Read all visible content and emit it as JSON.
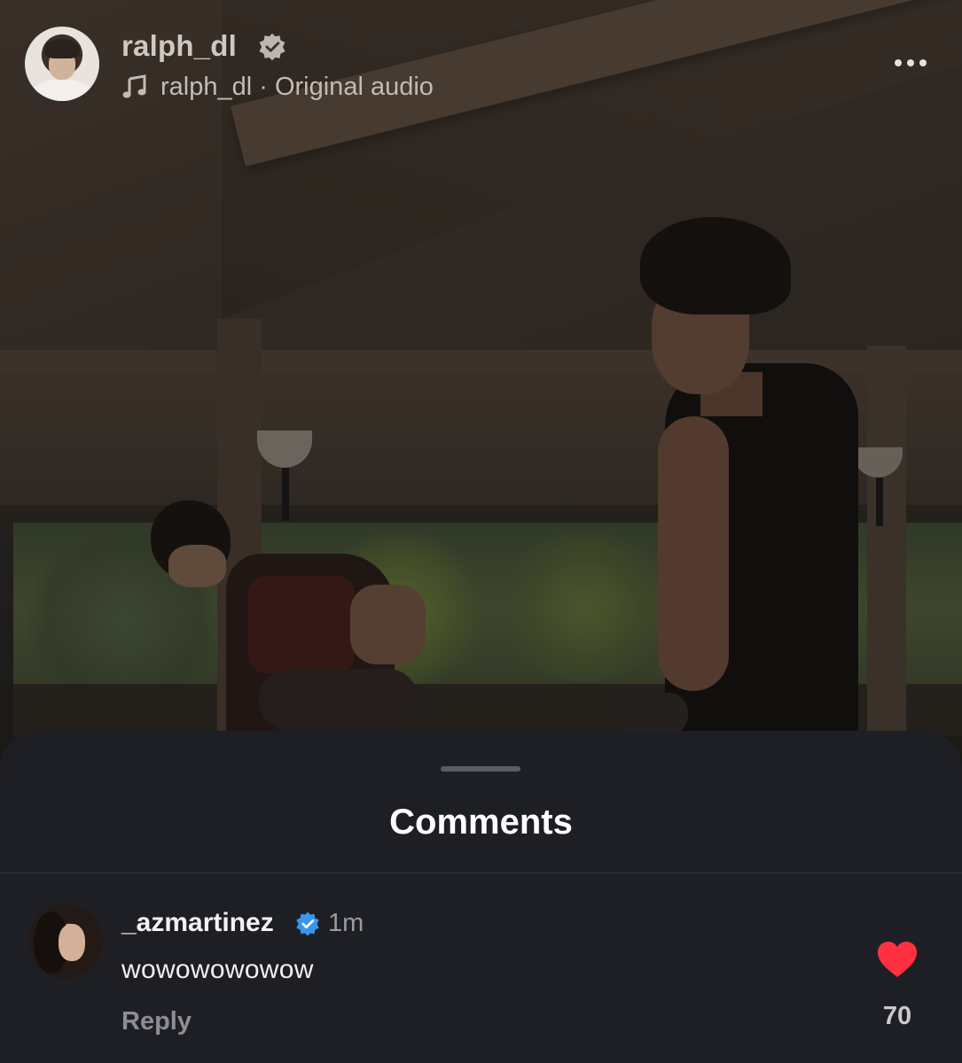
{
  "post": {
    "username": "ralph_dl",
    "verified": true,
    "audio_text": "ralph_dl · Original audio",
    "icons": {
      "verified": "verified-badge-icon",
      "audio": "music-note-icon",
      "more": "more-options-icon"
    }
  },
  "comments_sheet": {
    "title": "Comments",
    "comments": [
      {
        "username": "_azmartinez",
        "verified": true,
        "time": "1m",
        "text": "wowowowowow",
        "reply_label": "Reply",
        "like_count": "70",
        "liked": true
      }
    ]
  },
  "colors": {
    "sheet_background": "#1e1f24",
    "verified_blue": "#3797f0",
    "like_red": "#ff3040",
    "secondary_text": "#8d8e94"
  }
}
